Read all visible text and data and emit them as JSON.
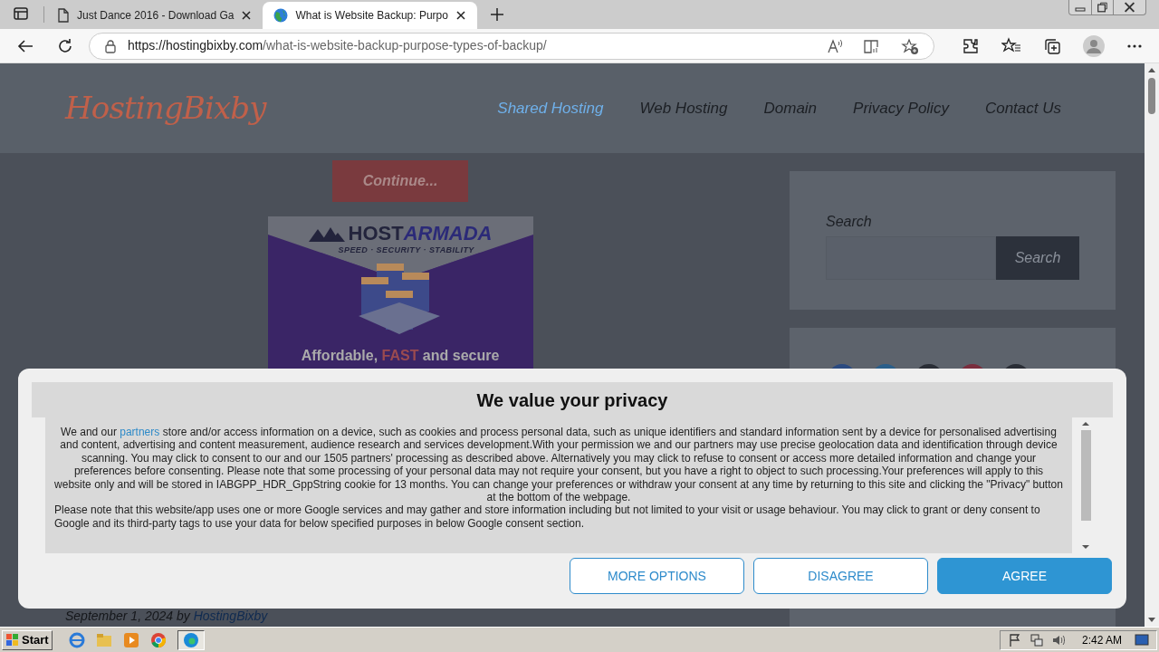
{
  "browser": {
    "tabs": [
      {
        "title": "Just Dance 2016 - Download Ga",
        "kind": "doc",
        "selected": false
      },
      {
        "title": "What is Website Backup: Purpo",
        "kind": "globe",
        "selected": true
      }
    ],
    "url_host": "https://hostingbixby.com",
    "url_path": "/what-is-website-backup-purpose-types-of-backup/"
  },
  "site": {
    "logo": "HostingBixby",
    "nav": [
      {
        "label": "Shared Hosting",
        "selected": true
      },
      {
        "label": "Web Hosting",
        "selected": false
      },
      {
        "label": "Domain",
        "selected": false
      },
      {
        "label": "Privacy Policy",
        "selected": false
      },
      {
        "label": "Contact Us",
        "selected": false
      }
    ],
    "continue_button": "Continue...",
    "ad": {
      "brand_a": "HOST",
      "brand_b": "ARMADA",
      "tagline": "SPEED · SECURITY · STABILITY",
      "footer_a": "Affordable, ",
      "footer_b": "FAST",
      "footer_c": " and secure"
    },
    "search": {
      "label": "Search",
      "button": "Search"
    },
    "post_meta": {
      "text": "September 1, 2024 by",
      "author": "HostingBixby"
    }
  },
  "consent": {
    "title": "We value your privacy",
    "intro": "We and our",
    "link": "partners",
    "paragraph_1": "store and/or access information on a device, such as cookies and process personal data, such as unique identifiers and standard information sent by a device for personalised advertising and content, advertising and content measurement, audience research and services development.With your permission we and our partners may use precise geolocation data and identification through device scanning. You may click to consent to our and our 1505 partners' processing as described above. Alternatively you may click to refuse to consent or access more detailed information and change your preferences before consenting. Please note that some processing of your personal data may not require your consent, but you have a right to object to such processing.Your preferences will apply to this website only and will be stored in IABGPP_HDR_GppString cookie for 13 months. You can change your preferences or withdraw your consent at any time by returning to this site and clicking the \"Privacy\" button at the bottom of the webpage.",
    "paragraph_2": "Please note that this website/app uses one or more Google services and may gather and store information including but not limited to your visit or usage behaviour. You may click to grant or deny consent to Google and its third-party tags to use your data for below specified purposes in below Google consent section.",
    "buttons": [
      {
        "label": "MORE OPTIONS",
        "kind": "outline"
      },
      {
        "label": "DISAGREE",
        "kind": "outline"
      },
      {
        "label": "AGREE",
        "kind": "filled"
      }
    ]
  },
  "taskbar": {
    "start": "Start",
    "time": "2:42 AM"
  }
}
